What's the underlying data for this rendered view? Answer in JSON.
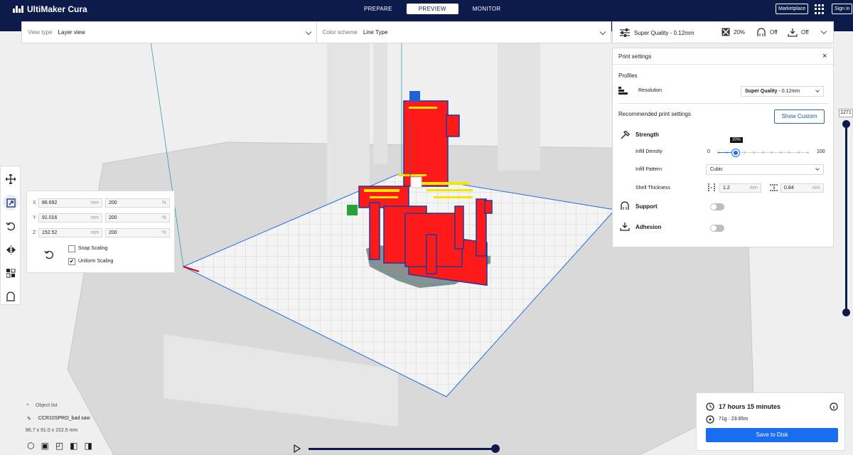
{
  "app": {
    "name": "UltiMaker Cura"
  },
  "stages": [
    {
      "label": "PREPARE",
      "active": false
    },
    {
      "label": "PREVIEW",
      "active": true
    },
    {
      "label": "MONITOR",
      "active": false
    }
  ],
  "topbar": {
    "marketplace": "Marketplace",
    "signin": "Sign in"
  },
  "viewbar": {
    "view_type_label": "View type",
    "view_type_value": "Layer view",
    "color_scheme_label": "Color scheme",
    "color_scheme_value": "Line Type"
  },
  "print_header": {
    "profile": "Super Quality - 0.12mm",
    "infill": "20%",
    "support": "Off",
    "adhesion": "Off"
  },
  "print_settings": {
    "title": "Print settings",
    "profiles_label": "Profiles",
    "resolution_label": "Resolution",
    "resolution_name": "Super Quality",
    "resolution_value": " - 0.12mm",
    "recommended_label": "Recommended print settings",
    "show_custom": "Show Custom",
    "strength_label": "Strength",
    "infill_density_label": "Infill Density",
    "infill_min": "0",
    "infill_max": "100",
    "infill_value": "20%",
    "infill_fraction": 0.2,
    "infill_pattern_label": "Infill Pattern",
    "infill_pattern_value": "Cubic",
    "shell_thickness_label": "Shell Thickness",
    "wall_thickness": "1.2",
    "top_bottom_thickness": "0.84",
    "unit_mm": "mm",
    "support_label": "Support",
    "adhesion_label": "Adhesion",
    "support_on": false,
    "adhesion_on": false
  },
  "layer_slider": {
    "label": "1271"
  },
  "scale": {
    "rows": [
      {
        "axis": "X",
        "mm": "86.692",
        "percent": "200"
      },
      {
        "axis": "Y",
        "mm": "91.016",
        "percent": "200"
      },
      {
        "axis": "Z",
        "mm": "152.52",
        "percent": "200"
      }
    ],
    "unit_mm": "mm",
    "unit_percent": "%",
    "snap_scaling": "Snap Scaling",
    "snap_checked": false,
    "uniform_scaling": "Uniform Scaling",
    "uniform_checked": true
  },
  "object_list": {
    "title": "Object list",
    "object_name": "CCR10SPRO_bad saw",
    "dimensions": "86.7 x 91.0 x 152.5 mm"
  },
  "estimate": {
    "time": "17 hours 15 minutes",
    "material": "71g · 23.65m",
    "save": "Save to Disk"
  },
  "colors": {
    "brand_dark": "#0d1b4a",
    "accent_blue": "#196ef0",
    "model_red": "#ff1a1a",
    "model_yellow": "#f3e600"
  }
}
